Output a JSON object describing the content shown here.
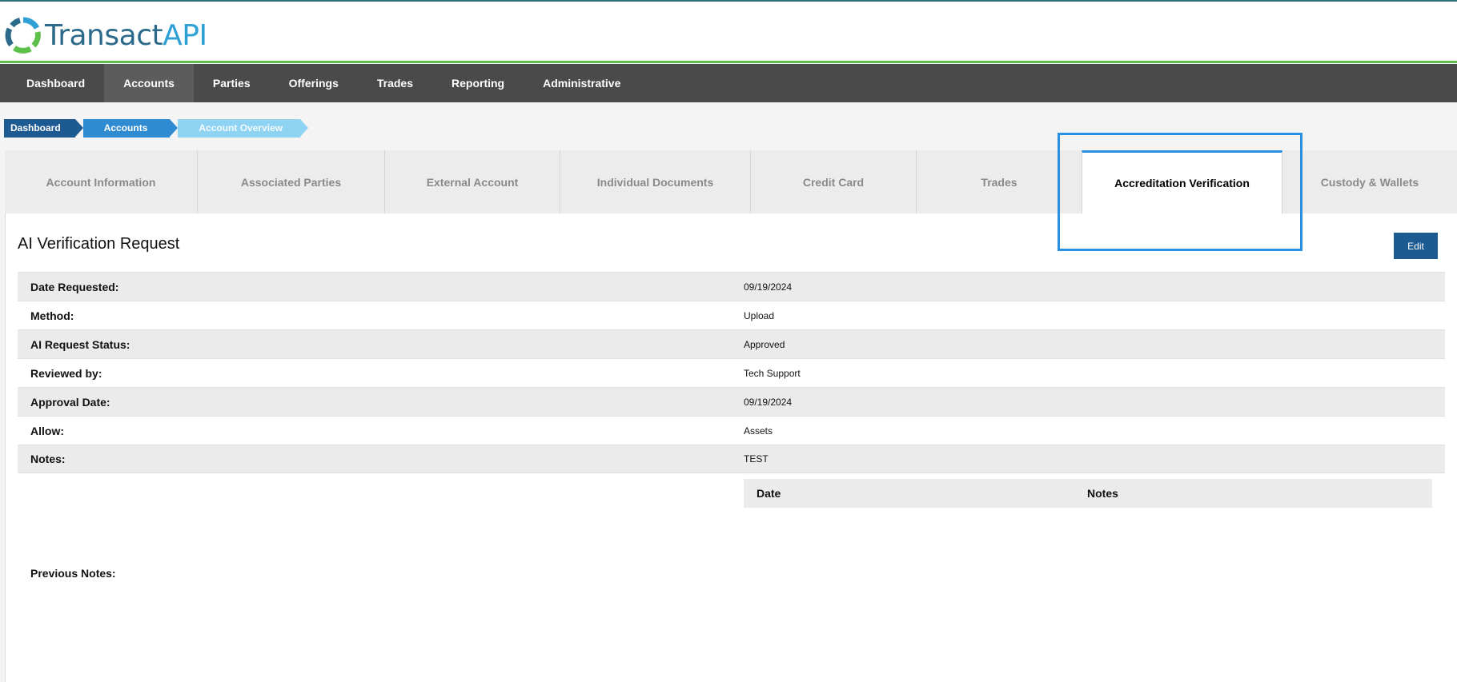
{
  "brand": {
    "name_part1": "Transact",
    "name_part2": "API"
  },
  "nav": {
    "items": [
      {
        "label": "Dashboard",
        "active": false
      },
      {
        "label": "Accounts",
        "active": true
      },
      {
        "label": "Parties",
        "active": false
      },
      {
        "label": "Offerings",
        "active": false
      },
      {
        "label": "Trades",
        "active": false
      },
      {
        "label": "Reporting",
        "active": false
      },
      {
        "label": "Administrative",
        "active": false
      }
    ]
  },
  "breadcrumb": [
    "Dashboard",
    "Accounts",
    "Account Overview"
  ],
  "tabs": [
    {
      "label": "Account Information",
      "active": false
    },
    {
      "label": "Associated Parties",
      "active": false
    },
    {
      "label": "External Account",
      "active": false
    },
    {
      "label": "Individual Documents",
      "active": false
    },
    {
      "label": "Credit Card",
      "active": false
    },
    {
      "label": "Trades",
      "active": false
    },
    {
      "label": "Accreditation Verification",
      "active": true
    },
    {
      "label": "Custody & Wallets",
      "active": false
    }
  ],
  "section": {
    "title": "AI Verification Request",
    "edit_label": "Edit"
  },
  "details": [
    {
      "label": "Date Requested:",
      "value": "09/19/2024"
    },
    {
      "label": "Method:",
      "value": "Upload"
    },
    {
      "label": "AI Request Status:",
      "value": "Approved"
    },
    {
      "label": "Reviewed by:",
      "value": "Tech Support"
    },
    {
      "label": "Approval Date:",
      "value": "09/19/2024"
    },
    {
      "label": "Allow:",
      "value": "Assets"
    },
    {
      "label": "Notes:",
      "value": "TEST"
    }
  ],
  "notes_table": {
    "col_date": "Date",
    "col_notes": "Notes"
  },
  "previous_notes_label": "Previous Notes:",
  "colors": {
    "nav_bg": "#4a4a4a",
    "accent_green": "#5cc04a",
    "primary_blue": "#1d5a92",
    "highlight_blue": "#2b8fe0"
  }
}
